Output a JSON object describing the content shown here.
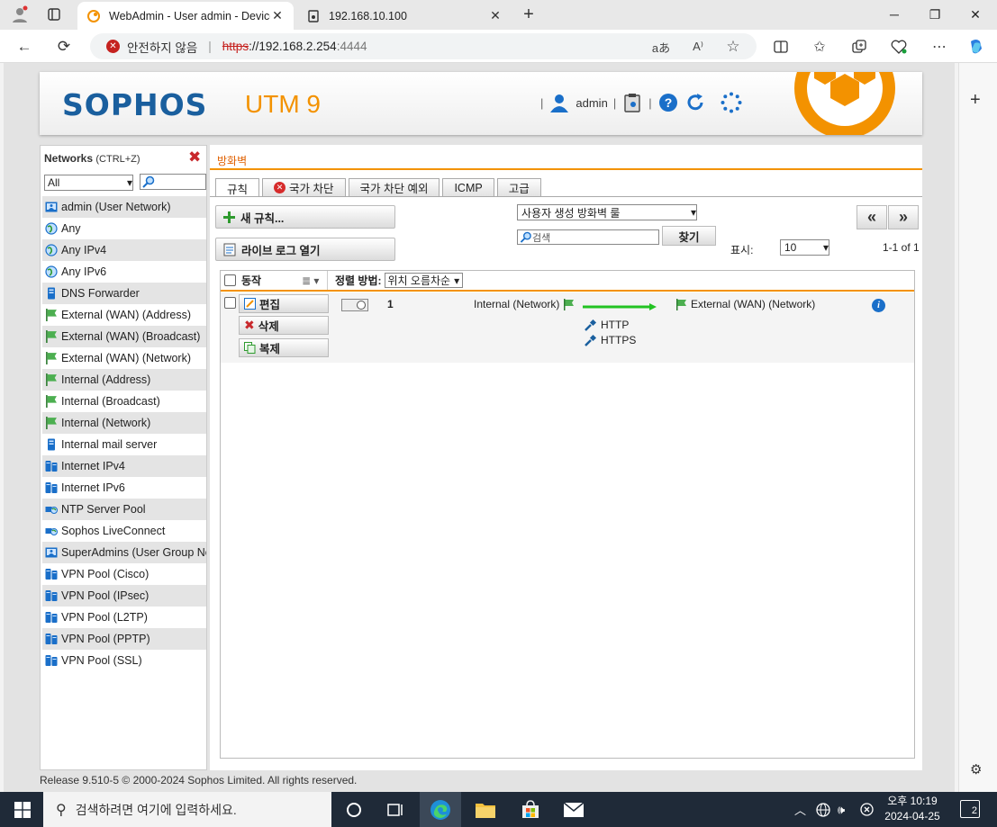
{
  "browser": {
    "tabs": [
      {
        "title": "WebAdmin - User admin - Device",
        "active": true
      },
      {
        "title": "192.168.10.100",
        "active": false
      }
    ],
    "address": {
      "security": "안전하지 않음",
      "scheme": "https",
      "separator": "://",
      "host": "192.168.2.254",
      "port": ":4444"
    }
  },
  "header": {
    "logo": "SOPHOS",
    "product": "UTM 9",
    "user": "admin",
    "accent_color": "#f39200",
    "brand_color": "#1a5f9e"
  },
  "sidebar": {
    "title": "Networks",
    "shortcut": "(CTRL+Z)",
    "filter": "All",
    "items": [
      {
        "label": "admin (User Network)",
        "icon": "user-network-icon"
      },
      {
        "label": "Any",
        "icon": "globe-icon"
      },
      {
        "label": "Any IPv4",
        "icon": "globe-icon"
      },
      {
        "label": "Any IPv6",
        "icon": "globe-icon"
      },
      {
        "label": "DNS Forwarder",
        "icon": "host-icon"
      },
      {
        "label": "External (WAN) (Address)",
        "icon": "interface-flag-icon"
      },
      {
        "label": "External (WAN) (Broadcast)",
        "icon": "interface-flag-icon"
      },
      {
        "label": "External (WAN) (Network)",
        "icon": "interface-flag-icon"
      },
      {
        "label": "Internal (Address)",
        "icon": "interface-flag-icon"
      },
      {
        "label": "Internal (Broadcast)",
        "icon": "interface-flag-icon"
      },
      {
        "label": "Internal (Network)",
        "icon": "interface-flag-icon"
      },
      {
        "label": "Internal mail server",
        "icon": "host-icon"
      },
      {
        "label": "Internet IPv4",
        "icon": "network-icon"
      },
      {
        "label": "Internet IPv6",
        "icon": "network-icon"
      },
      {
        "label": "NTP Server Pool",
        "icon": "network-group-icon"
      },
      {
        "label": "Sophos LiveConnect",
        "icon": "network-group-icon"
      },
      {
        "label": "SuperAdmins (User Group Network)",
        "icon": "user-network-icon"
      },
      {
        "label": "VPN Pool (Cisco)",
        "icon": "network-icon"
      },
      {
        "label": "VPN Pool (IPsec)",
        "icon": "network-icon"
      },
      {
        "label": "VPN Pool (L2TP)",
        "icon": "network-icon"
      },
      {
        "label": "VPN Pool (PPTP)",
        "icon": "network-icon"
      },
      {
        "label": "VPN Pool (SSL)",
        "icon": "network-icon"
      }
    ]
  },
  "main": {
    "breadcrumb": "방화벽",
    "tabs": [
      "규칙",
      "국가 차단",
      "국가 차단 예외",
      "ICMP",
      "고급"
    ],
    "new_rule": "새 규칙...",
    "live_log": "라이브 로그 열기",
    "filter_select": "사용자 생성 방화벽 룰",
    "search_placeholder": "검색",
    "find": "찾기",
    "show_label": "표시:",
    "show_value": "10",
    "count": "1-1 of 1",
    "grid": {
      "action_col": "동작",
      "sort_label": "정렬 방법:",
      "sort_value": "위치 오름차순"
    },
    "rule": {
      "number": "1",
      "edit": "편집",
      "delete": "삭제",
      "clone": "복제",
      "source": "Internal (Network)",
      "destination": "External (WAN) (Network)",
      "services": [
        "HTTP",
        "HTTPS"
      ]
    }
  },
  "footer": "Release 9.510-5 © 2000-2024 Sophos Limited. All rights reserved.",
  "taskbar": {
    "search": "검색하려면 여기에 입력하세요.",
    "time": "오후 10:19",
    "date": "2024-04-25",
    "notifications": "2"
  }
}
